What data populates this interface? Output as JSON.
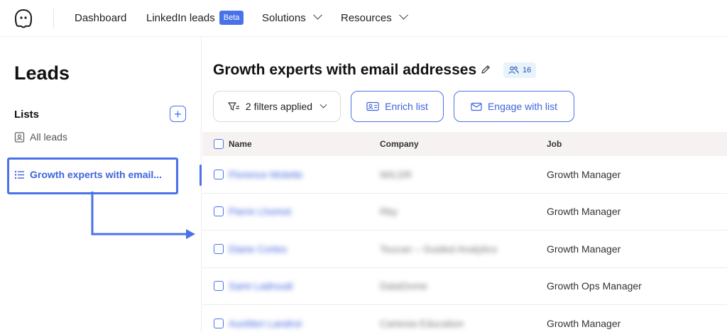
{
  "nav": {
    "items": [
      {
        "label": "Dashboard"
      },
      {
        "label": "LinkedIn leads",
        "badge": "Beta"
      },
      {
        "label": "Solutions"
      },
      {
        "label": "Resources"
      }
    ]
  },
  "sidebar": {
    "title": "Leads",
    "lists_label": "Lists",
    "add_icon": "+",
    "all_leads": "All leads",
    "active_list": "Growth experts with email..."
  },
  "main": {
    "title": "Growth experts with email addresses",
    "count": "16",
    "filter_button": "2 filters applied",
    "enrich_button": "Enrich list",
    "engage_button": "Engage with list"
  },
  "table": {
    "headers": {
      "name": "Name",
      "company": "Company",
      "job": "Job"
    },
    "rows": [
      {
        "name": "Florence Molette",
        "company": "WILDR",
        "job": "Growth Manager"
      },
      {
        "name": "Pierre Lhomot",
        "company": "Rby",
        "job": "Growth Manager"
      },
      {
        "name": "Diane Cortes",
        "company": "Toucan – Guided Analytics",
        "job": "Growth Manager"
      },
      {
        "name": "Sami Ladroudi",
        "company": "DataDome",
        "job": "Growth Ops Manager"
      },
      {
        "name": "Aurélien Landrot",
        "company": "Cartesia Education",
        "job": "Growth Manager"
      }
    ]
  },
  "colors": {
    "accent": "#4a72e8",
    "header_bg": "#f7f2f2",
    "badge_bg": "#e8f4fb"
  },
  "icons": [
    "ghost-logo-icon",
    "chevron-down-icon",
    "plus-icon",
    "contact-card-icon",
    "list-icon",
    "pencil-icon",
    "users-icon",
    "filter-icon",
    "enrich-card-icon",
    "mail-icon"
  ]
}
